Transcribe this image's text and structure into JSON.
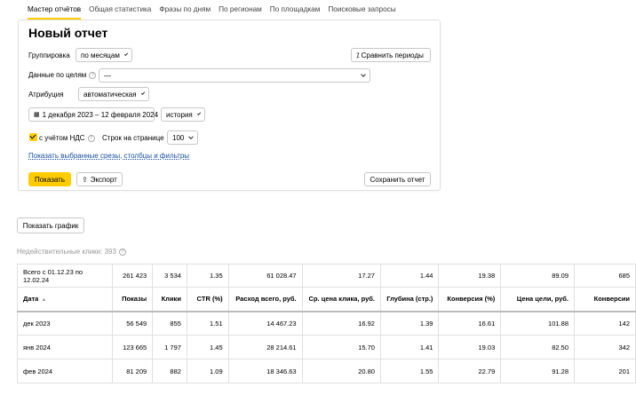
{
  "tabs": [
    "Мастер отчётов",
    "Общая статистика",
    "Фразы по дням",
    "По регионам",
    "По площадкам",
    "Поисковые запросы"
  ],
  "panel": {
    "title": "Новый отчет",
    "grouping_label": "Группировка",
    "grouping_value": "по месяцам",
    "compare_button": "Сравнить периоды",
    "goals_label": "Данные по целям",
    "goals_value": "—",
    "attribution_label": "Атрибуция",
    "attribution_value": "автоматическая",
    "date_range": "1 декабря 2023 – 12 февраля 2024",
    "history_value": "история",
    "vat_label": "с учётом НДС",
    "rows_label": "Строк на странице",
    "rows_value": "100",
    "filters_link": "Показать выбранные срезы, столбцы и фильтры",
    "show_button": "Показать",
    "export_button": "Экспорт",
    "save_button": "Сохранить отчет"
  },
  "chart_button": "Показать график",
  "invalid_clicks": "Недействительные клики: 393",
  "table": {
    "total": [
      "Всего с 01.12.23 по 12.02.24",
      "261 423",
      "3 534",
      "1.35",
      "61 028.47",
      "17.27",
      "1.44",
      "19.38",
      "89.09",
      "685"
    ],
    "headers": [
      "Дата",
      "Показы",
      "Клики",
      "CTR (%)",
      "Расход всего, руб.",
      "Ср. цена клика, руб.",
      "Глубина (стр.)",
      "Конверсия (%)",
      "Цена цели, руб.",
      "Конверсии"
    ],
    "rows": [
      [
        "дек 2023",
        "56 549",
        "855",
        "1.51",
        "14 467.23",
        "16.92",
        "1.39",
        "16.61",
        "101.88",
        "142"
      ],
      [
        "янв 2024",
        "123 665",
        "1 797",
        "1.45",
        "28 214.61",
        "15.70",
        "1.41",
        "19.03",
        "82.50",
        "342"
      ],
      [
        "фев 2024",
        "81 209",
        "882",
        "1.09",
        "18 346.63",
        "20.80",
        "1.55",
        "22.79",
        "91.28",
        "201"
      ]
    ]
  }
}
